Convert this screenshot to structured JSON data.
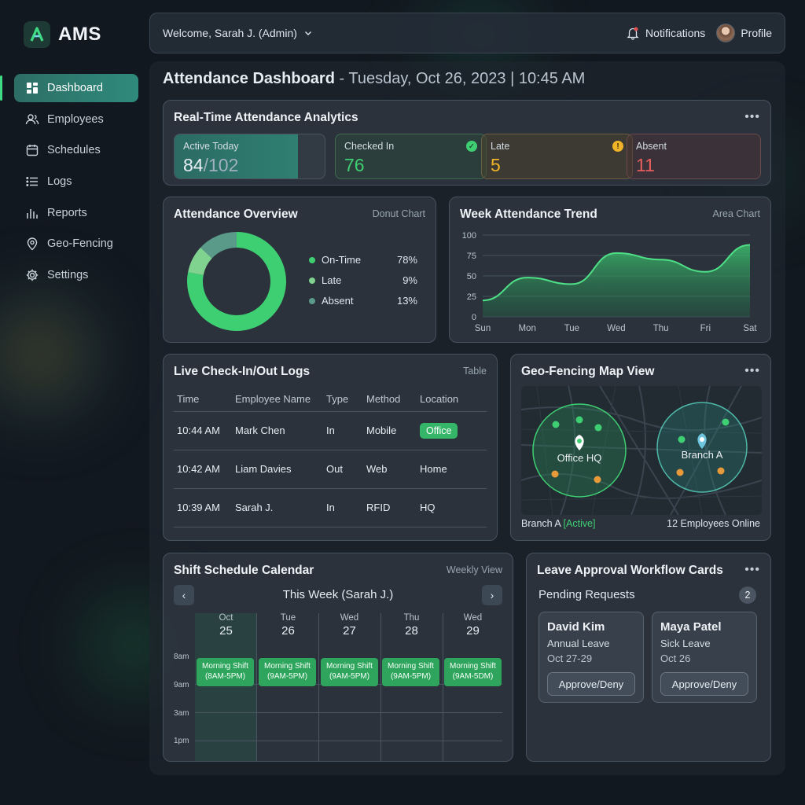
{
  "app": {
    "name": "AMS"
  },
  "sidebar": {
    "items": [
      {
        "label": "Dashboard",
        "icon": "dashboard-icon",
        "active": true
      },
      {
        "label": "Employees",
        "icon": "users-icon"
      },
      {
        "label": "Schedules",
        "icon": "calendar-icon"
      },
      {
        "label": "Logs",
        "icon": "list-icon"
      },
      {
        "label": "Reports",
        "icon": "bar-chart-icon"
      },
      {
        "label": "Geo-Fencing",
        "icon": "location-pin-icon"
      },
      {
        "label": "Settings",
        "icon": "gear-icon"
      }
    ]
  },
  "topbar": {
    "welcome": "Welcome, Sarah J. (Admin)",
    "notifications": "Notifications",
    "profile": "Profile"
  },
  "page": {
    "title": "Attendance Dashboard",
    "separator": "-",
    "date": "Tuesday, Oct 26, 2023",
    "time": "| 10:45 AM"
  },
  "analytics": {
    "title": "Real-Time Attendance Analytics",
    "active": {
      "label": "Active Today",
      "value": "84",
      "total": "/102",
      "fraction": 0.82
    },
    "checked_in": {
      "label": "Checked In",
      "value": "76"
    },
    "late": {
      "label": "Late",
      "value": "5"
    },
    "absent": {
      "label": "Absent",
      "value": "11"
    }
  },
  "overview": {
    "title": "Attendance Overview",
    "tag": "Donut Chart",
    "legend": [
      {
        "label": "On-Time",
        "pct": "78%",
        "color": "#3fcf73"
      },
      {
        "label": "Late",
        "pct": "9%",
        "color": "#7fd38f"
      },
      {
        "label": "Absent",
        "pct": "13%",
        "color": "#5a9a88"
      }
    ]
  },
  "trend": {
    "title": "Week Attendance Trend",
    "tag": "Area Chart"
  },
  "chart_data": [
    {
      "type": "pie",
      "title": "Attendance Overview",
      "categories": [
        "On-Time",
        "Late",
        "Absent"
      ],
      "values": [
        78,
        9,
        13
      ]
    },
    {
      "type": "area",
      "title": "Week Attendance Trend",
      "categories": [
        "Sun",
        "Mon",
        "Tue",
        "Wed",
        "Thu",
        "Fri",
        "Sat"
      ],
      "values": [
        20,
        48,
        40,
        78,
        70,
        55,
        88
      ],
      "ylim": [
        0,
        100
      ],
      "yticks": [
        "100",
        "75",
        "50",
        "25",
        "0"
      ],
      "grid": true
    }
  ],
  "logs": {
    "title": "Live Check-In/Out Logs",
    "tag": "Table",
    "columns": [
      "Time",
      "Employee Name",
      "Type",
      "Method",
      "Location"
    ],
    "rows": [
      [
        "10:44 AM",
        "Mark Chen",
        "In",
        "Mobile",
        "Office"
      ],
      [
        "10:42 AM",
        "Liam Davies",
        "Out",
        "Web",
        "Home"
      ],
      [
        "10:39 AM",
        "Sarah J.",
        "In",
        "RFID",
        "HQ"
      ]
    ]
  },
  "geo": {
    "title": "Geo-Fencing Map View",
    "zone1": "Office HQ",
    "zone2": "Branch A",
    "footer_branch": "Branch A",
    "footer_status": "[Active]",
    "footer_online": "12 Employees Online"
  },
  "schedule": {
    "title": "Shift Schedule Calendar",
    "tag": "Weekly View",
    "week": "This Week (Sarah J.)",
    "days": [
      {
        "name": "Oct",
        "date": "25",
        "shift": "Morning Shift",
        "hours": "(8AM-5PM)"
      },
      {
        "name": "Tue",
        "date": "26",
        "shift": "Morning Shift",
        "hours": "(9AM-5PM)"
      },
      {
        "name": "Wed",
        "date": "27",
        "shift": "Morning Shift",
        "hours": "(9AM-5PM)"
      },
      {
        "name": "Thu",
        "date": "28",
        "shift": "Morning Shift",
        "hours": "(9AM-5PM)"
      },
      {
        "name": "Wed",
        "date": "29",
        "shift": "Morning Shift",
        "hours": "(9AM-5DM)"
      }
    ],
    "times": [
      "8am",
      "9am",
      "3am",
      "1pm"
    ]
  },
  "leave": {
    "title": "Leave Approval Workflow Cards",
    "pending_label": "Pending Requests",
    "pending_count": "2",
    "requests": [
      {
        "name": "David Kim",
        "type": "Annual Leave",
        "dates": "Oct 27-29",
        "action": "Approve/Deny"
      },
      {
        "name": "Maya Patel",
        "type": "Sick Leave",
        "dates": "Oct 26",
        "action": "Approve/Deny"
      }
    ]
  }
}
